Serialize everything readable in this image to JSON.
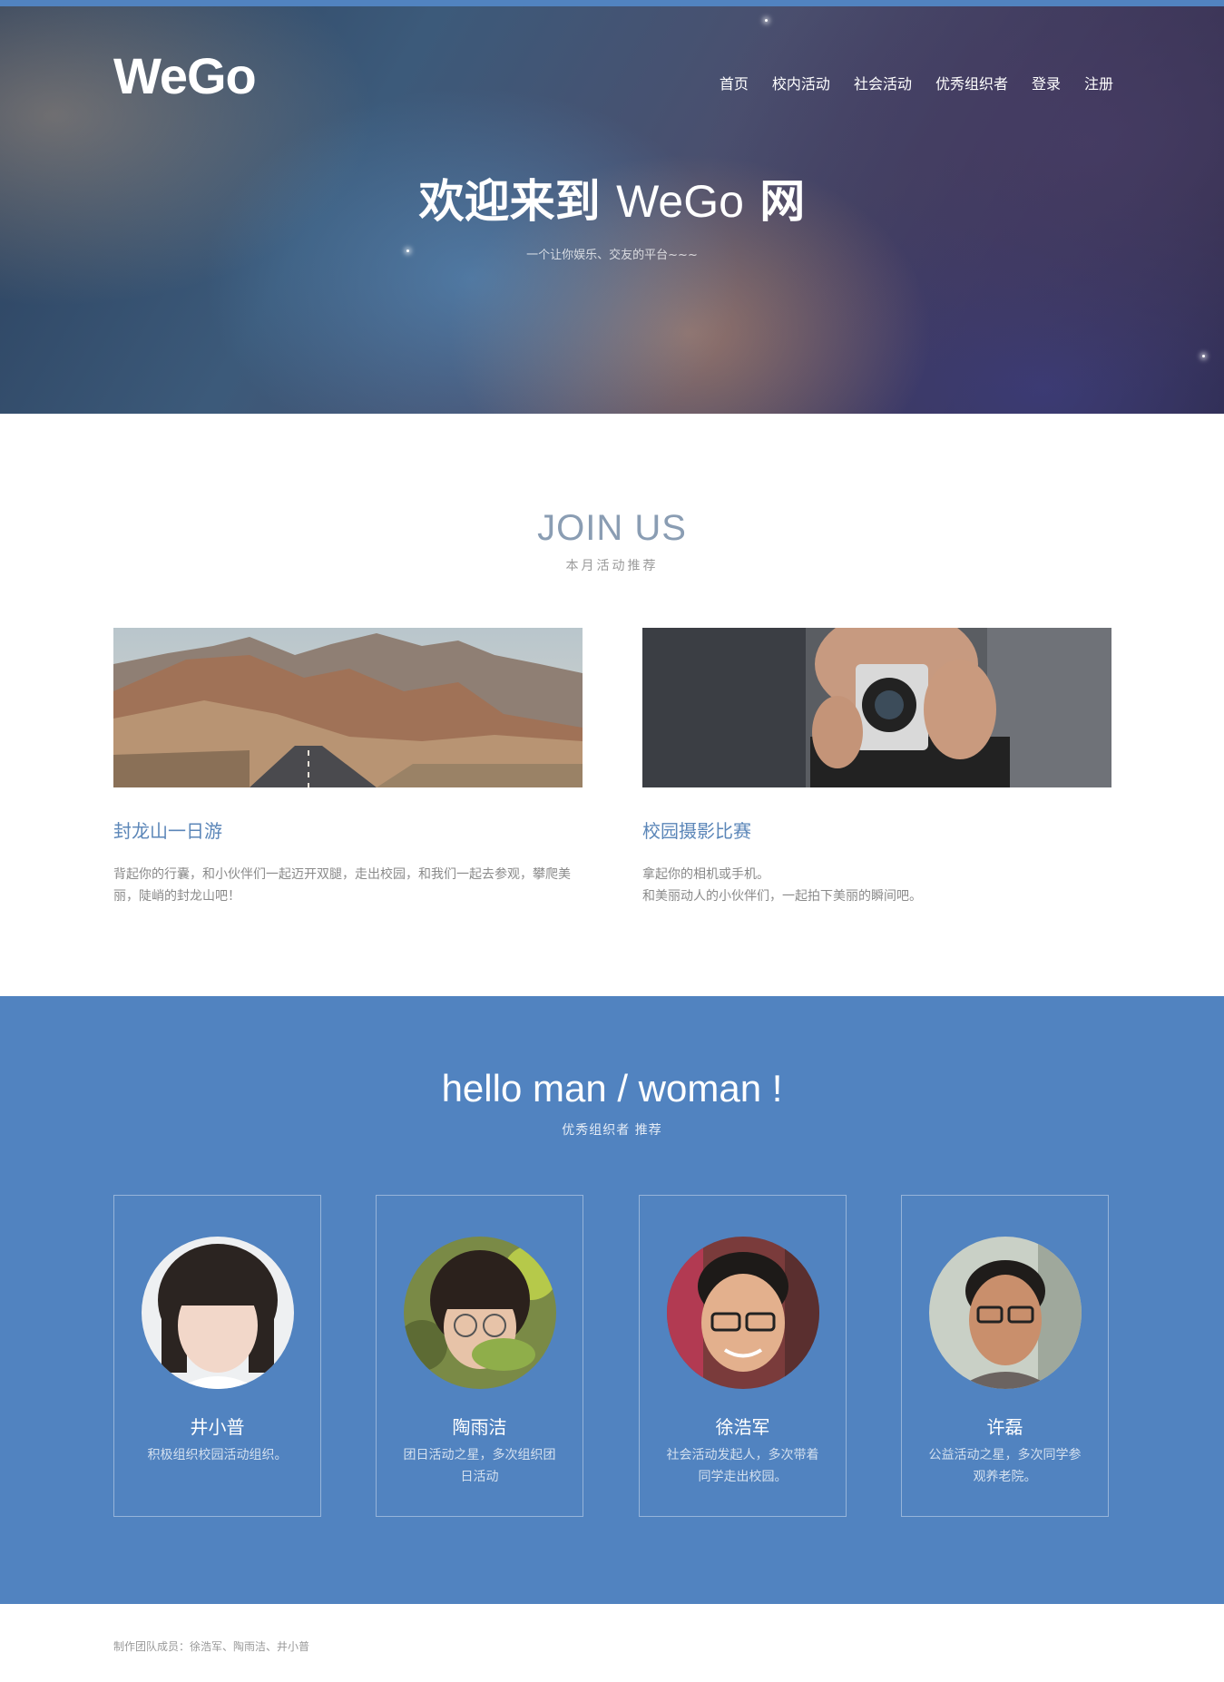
{
  "header": {
    "logo": "WeGo",
    "nav": [
      "首页",
      "校内活动",
      "社会活动",
      "优秀组织者",
      "登录",
      "注册"
    ]
  },
  "hero": {
    "title_prefix": "欢迎来到 ",
    "title_brand": "WeGo",
    "title_suffix": " 网",
    "subtitle": "一个让你娱乐、交友的平台~~~"
  },
  "join": {
    "title": "JOIN US",
    "subtitle": "本月活动推荐",
    "cards": [
      {
        "title": "封龙山一日游",
        "desc": "背起你的行囊，和小伙伴们一起迈开双腿，走出校园，和我们一起去参观，攀爬美丽，陡峭的封龙山吧！"
      },
      {
        "title": "校园摄影比赛",
        "desc_line1": "拿起你的相机或手机。",
        "desc_line2": "和美丽动人的小伙伴们，一起拍下美丽的瞬间吧。"
      }
    ]
  },
  "organizers": {
    "title": "hello man / woman !",
    "subtitle": "优秀组织者 推荐",
    "people": [
      {
        "name": "井小普",
        "desc": "积极组织校园活动组织。"
      },
      {
        "name": "陶雨洁",
        "desc": "团日活动之星，多次组织团日活动"
      },
      {
        "name": "徐浩军",
        "desc": "社会活动发起人，多次带着同学走出校园。"
      },
      {
        "name": "许磊",
        "desc": "公益活动之星，多次同学参观养老院。"
      }
    ]
  },
  "footer": {
    "text": "制作团队成员：徐浩军、陶雨洁、井小普"
  },
  "colors": {
    "accent": "#5183c0",
    "card_title": "#5b86b8"
  }
}
